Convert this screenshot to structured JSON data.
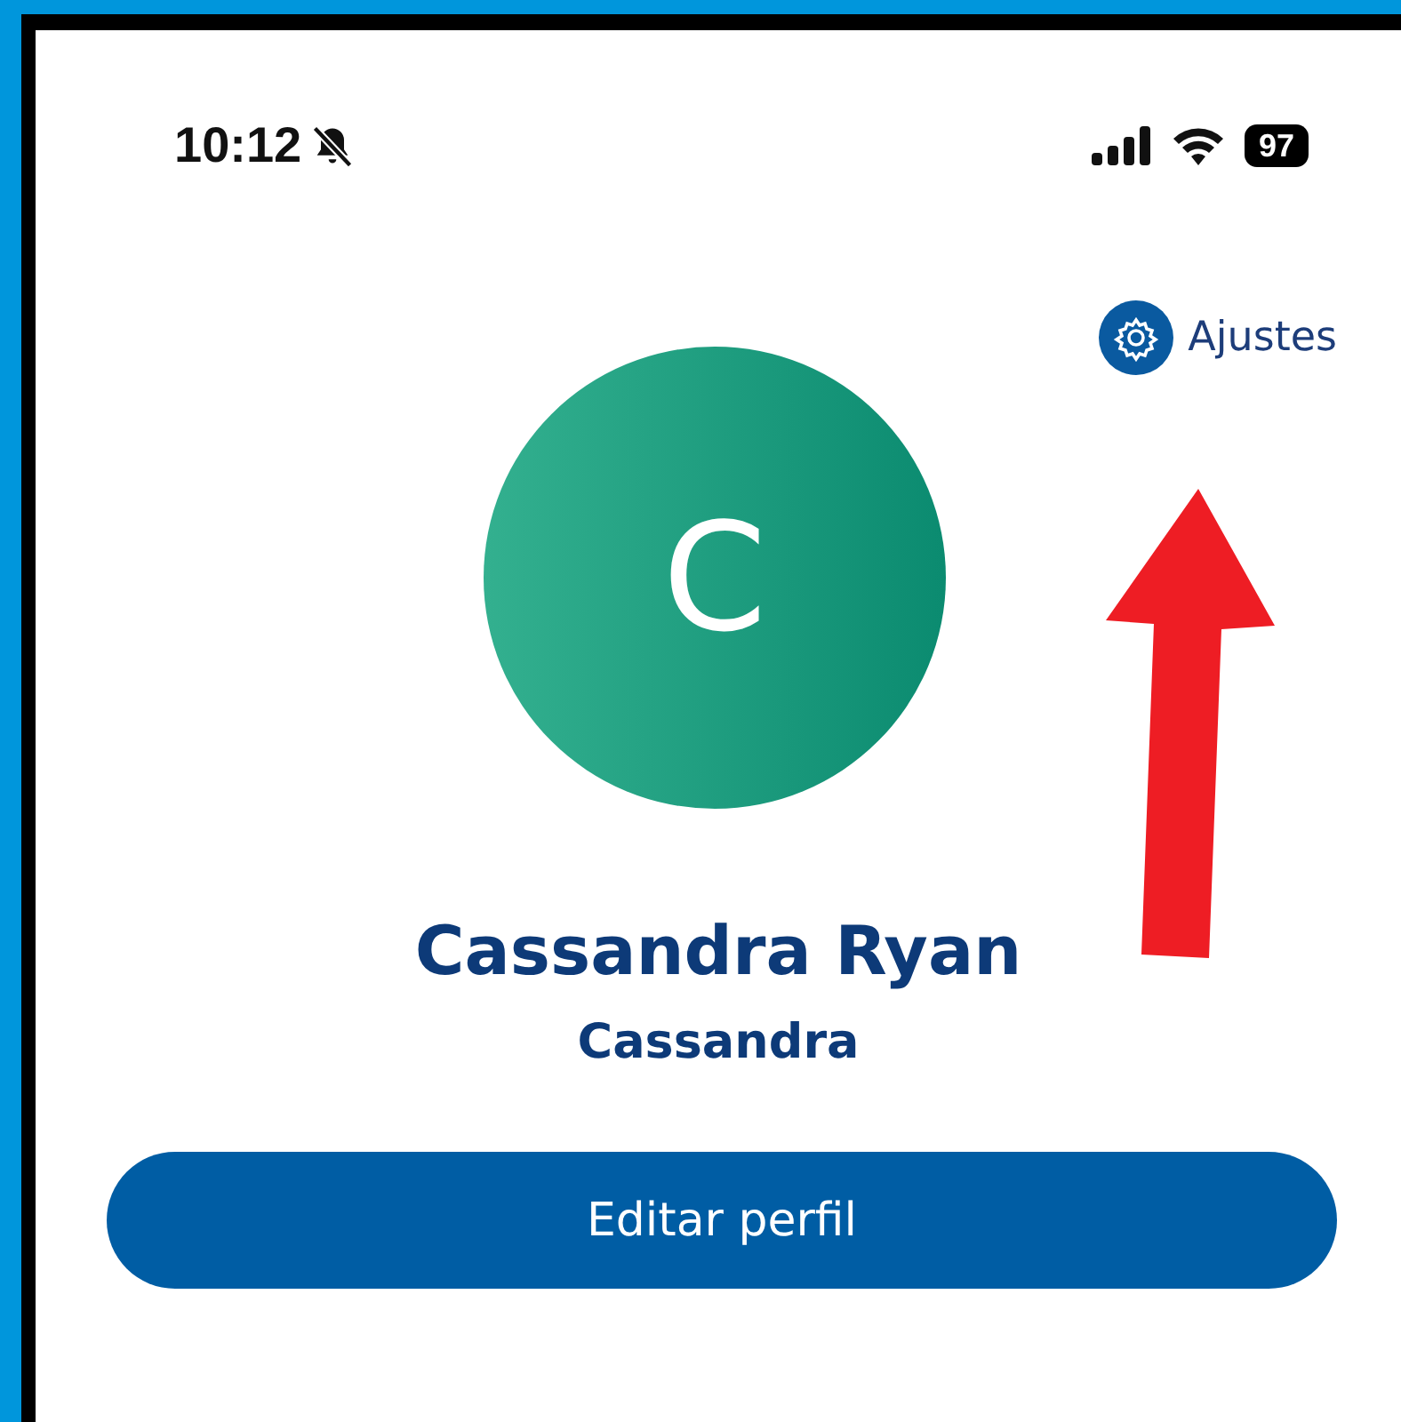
{
  "status_bar": {
    "time": "10:12",
    "silent": true,
    "battery": "97"
  },
  "settings_link": {
    "label": "Ajustes"
  },
  "profile": {
    "avatar_letter": "C",
    "full_name": "Cassandra Ryan",
    "username": "Cassandra"
  },
  "edit_button": {
    "label": "Editar perfil"
  },
  "annotation": {
    "kind": "arrow"
  }
}
